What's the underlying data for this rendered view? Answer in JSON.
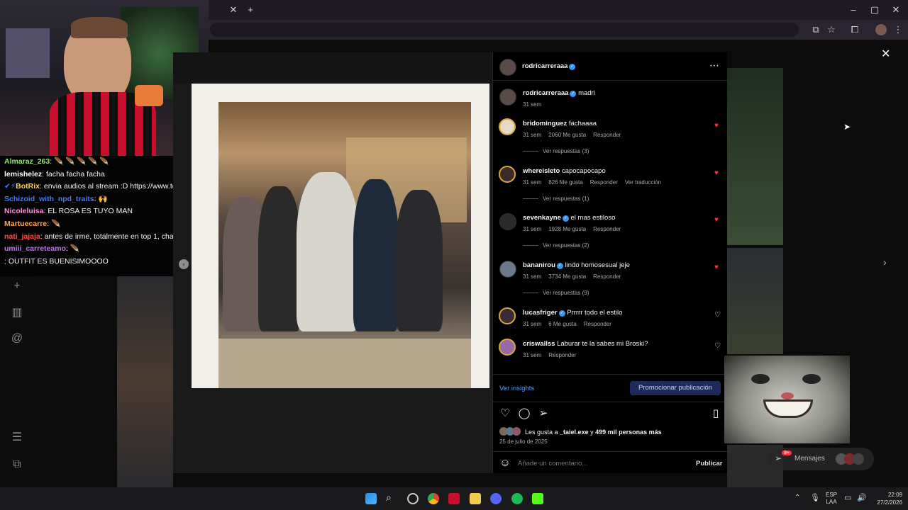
{
  "browser": {
    "new_tab_icon": "plus-icon",
    "close_tab_icon": "close-icon",
    "window_controls": {
      "minimize": "–",
      "maximize": "▢",
      "close": "✕"
    }
  },
  "chat": {
    "lines": [
      {
        "user": "Almaraz_263",
        "user_color": "#9be36d",
        "text": " 🪶 🪶 🪶 🪶 🪶"
      },
      {
        "user": "lemishelez",
        "user_color": "#ffffff",
        "text": " facha facha facha"
      },
      {
        "user": "BotRix",
        "user_color": "#ffd23f",
        "text": " envia audios al stream :D https://www.tonoclip.c"
      },
      {
        "user": "Schizoid_with_npd_traits",
        "user_color": "#3e7bff",
        "text": " 🙌"
      },
      {
        "user": "Nicoleluisa",
        "user_color": "#ff8fd8",
        "text": " EL ROSA ES TUYO MAN"
      },
      {
        "user": "Martuecarre",
        "user_color": "#ffa24a",
        "text": " 🪶"
      },
      {
        "user": "nati_jajaja",
        "user_color": "#ff4a4a",
        "text": " antes de irme, totalmente en top 1, cha"
      },
      {
        "user": "umiii_carreteamo",
        "user_color": "#c86bff",
        "text": " 🪶"
      },
      {
        "user": "",
        "user_color": "#ffffff",
        "text": ": OUTFIT ES BUENISIMOOOO"
      }
    ]
  },
  "post": {
    "author": "rodricarreraaa",
    "caption": "madri",
    "caption_time": "31 sem",
    "comments": [
      {
        "user": "bridominguez",
        "verified": false,
        "text": "fachaaaa",
        "time": "31 sem",
        "likes": "2060 Me gusta",
        "reply": "Responder",
        "translate": "",
        "replies": "Ver respuestas (3)",
        "liked": true
      },
      {
        "user": "whereisleto",
        "verified": false,
        "text": "capocapocapo",
        "time": "31 sem",
        "likes": "826 Me gusta",
        "reply": "Responder",
        "translate": "Ver traducción",
        "replies": "Ver respuestas (1)",
        "liked": true
      },
      {
        "user": "sevenkayne",
        "verified": true,
        "text": "el mas estiloso",
        "time": "31 sem",
        "likes": "1928 Me gusta",
        "reply": "Responder",
        "translate": "",
        "replies": "Ver respuestas (2)",
        "liked": true
      },
      {
        "user": "bananirou",
        "verified": true,
        "text": "lindo homosesual jeje",
        "time": "31 sem",
        "likes": "3734 Me gusta",
        "reply": "Responder",
        "translate": "",
        "replies": "Ver respuestas (9)",
        "liked": true
      },
      {
        "user": "lucasfriger",
        "verified": true,
        "text": "Prrrrr todo el estilo",
        "time": "31 sem",
        "likes": "6 Me gusta",
        "reply": "Responder",
        "translate": "",
        "replies": "",
        "liked": false
      },
      {
        "user": "criswallss",
        "verified": false,
        "text": "Laburar te la sabes mi Broski?",
        "time": "31 sem",
        "likes": "",
        "reply": "Responder",
        "translate": "",
        "replies": "",
        "liked": false
      }
    ],
    "insights_label": "Ver insights",
    "promote_label": "Promocionar publicación",
    "likes_text_prefix": "Les gusta a ",
    "likes_user": "_taiel.exe",
    "likes_text_mid": " y ",
    "likes_count": "499 mil personas más",
    "date": "25 de julio de 2025",
    "comment_placeholder": "Añade un comentario...",
    "publish_label": "Publicar"
  },
  "messages": {
    "label": "Mensajes",
    "badge": "9+"
  },
  "taskbar": {
    "lang_top": "ESP",
    "lang_bottom": "LAA",
    "time": "22:09",
    "date": "27/2/2026"
  },
  "colors": {
    "heart": "#ff3040",
    "accent_blue": "#3897f0",
    "insights_blue": "#5b9df9"
  }
}
